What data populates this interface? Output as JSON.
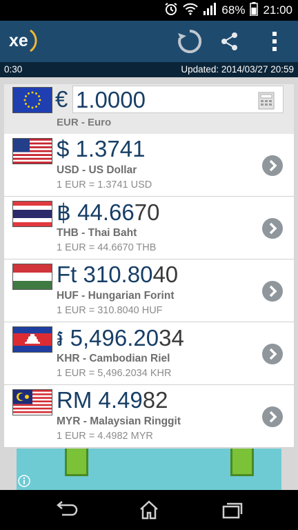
{
  "status_bar": {
    "battery": "68%",
    "time": "21:00"
  },
  "app": {
    "logo_text": "xe"
  },
  "info_bar": {
    "countdown": "0:30",
    "updated": "Updated:  2014/03/27 20:59"
  },
  "base": {
    "symbol": "€",
    "amount": "1.0000",
    "name": "EUR - Euro"
  },
  "rows": [
    {
      "code": "usd",
      "symbol": "$",
      "value_main": "1.3741",
      "value_dim": "",
      "name": "USD - US Dollar",
      "rate": "1 EUR = 1.3741 USD"
    },
    {
      "code": "thb",
      "symbol": "฿",
      "value_main": "44.66",
      "value_dim": "70",
      "name": "THB - Thai Baht",
      "rate": "1 EUR = 44.6670 THB"
    },
    {
      "code": "huf",
      "symbol": "Ft",
      "value_main": "310.80",
      "value_dim": "40",
      "name": "HUF - Hungarian Forint",
      "rate": "1 EUR = 310.8040 HUF"
    },
    {
      "code": "khr",
      "symbol": "៛",
      "value_main": "5,496.20",
      "value_dim": "34",
      "name": "KHR - Cambodian Riel",
      "rate": "1 EUR = 5,496.2034 KHR"
    },
    {
      "code": "myr",
      "symbol": "RM",
      "value_main": "4.49",
      "value_dim": "82",
      "name": "MYR - Malaysian Ringgit",
      "rate": "1 EUR = 4.4982 MYR"
    }
  ],
  "colors": {
    "app_bar": "#1e4a6e",
    "value_text": "#173e66",
    "info_bar": "#0b2438",
    "chevron": "#8f969c"
  }
}
